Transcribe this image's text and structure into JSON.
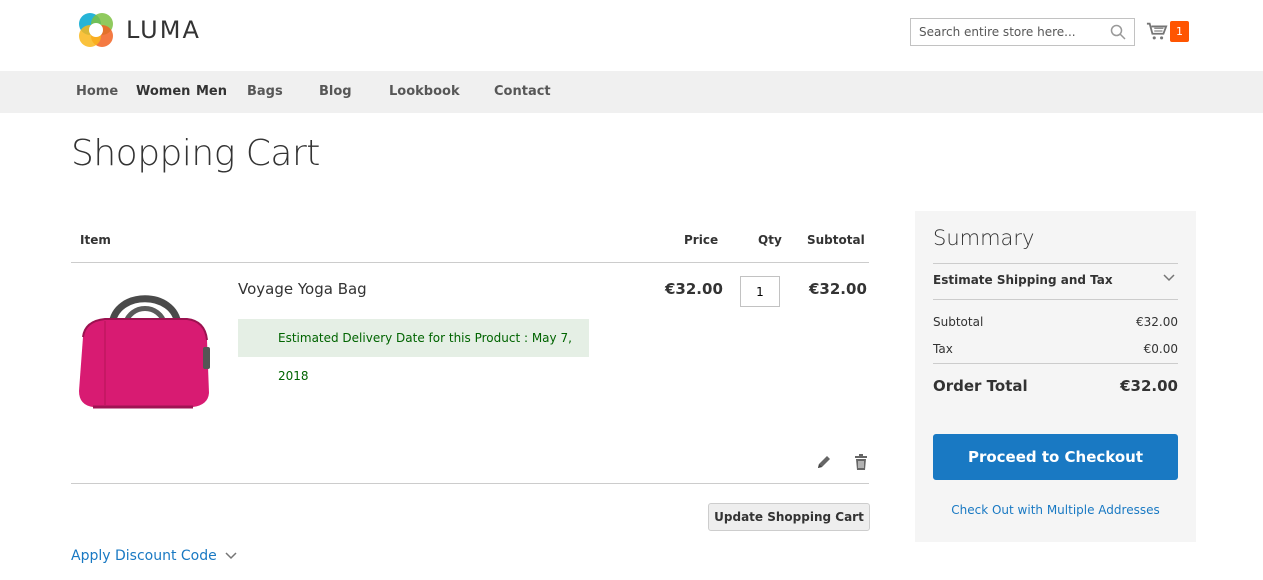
{
  "header": {
    "logo_text": "LUMA",
    "search_placeholder": "Search entire store here...",
    "cart_count": "1",
    "accent_color": "#ff5501"
  },
  "nav": {
    "items": [
      "Home",
      "Women",
      "Men",
      "Bags",
      "Blog",
      "Lookbook",
      "Contact"
    ]
  },
  "page": {
    "title": "Shopping Cart"
  },
  "cart": {
    "columns": [
      "Item",
      "Price",
      "Qty",
      "Subtotal"
    ],
    "items": [
      {
        "name": "Voyage Yoga Bag",
        "delivery_note": "Estimated Delivery Date for this Product : May 7, 2018",
        "price": "€32.00",
        "qty": "1",
        "subtotal": "€32.00"
      }
    ],
    "update_label": "Update Shopping Cart",
    "discount_label": "Apply Discount Code"
  },
  "summary": {
    "title": "Summary",
    "estimate_label": "Estimate Shipping and Tax",
    "subtotal_label": "Subtotal",
    "subtotal_value": "€32.00",
    "tax_label": "Tax",
    "tax_value": "€0.00",
    "order_total_label": "Order Total",
    "order_total_value": "€32.00",
    "checkout_label": "Proceed to Checkout",
    "multi_label": "Check Out with Multiple Addresses",
    "button_color": "#1979c3"
  }
}
